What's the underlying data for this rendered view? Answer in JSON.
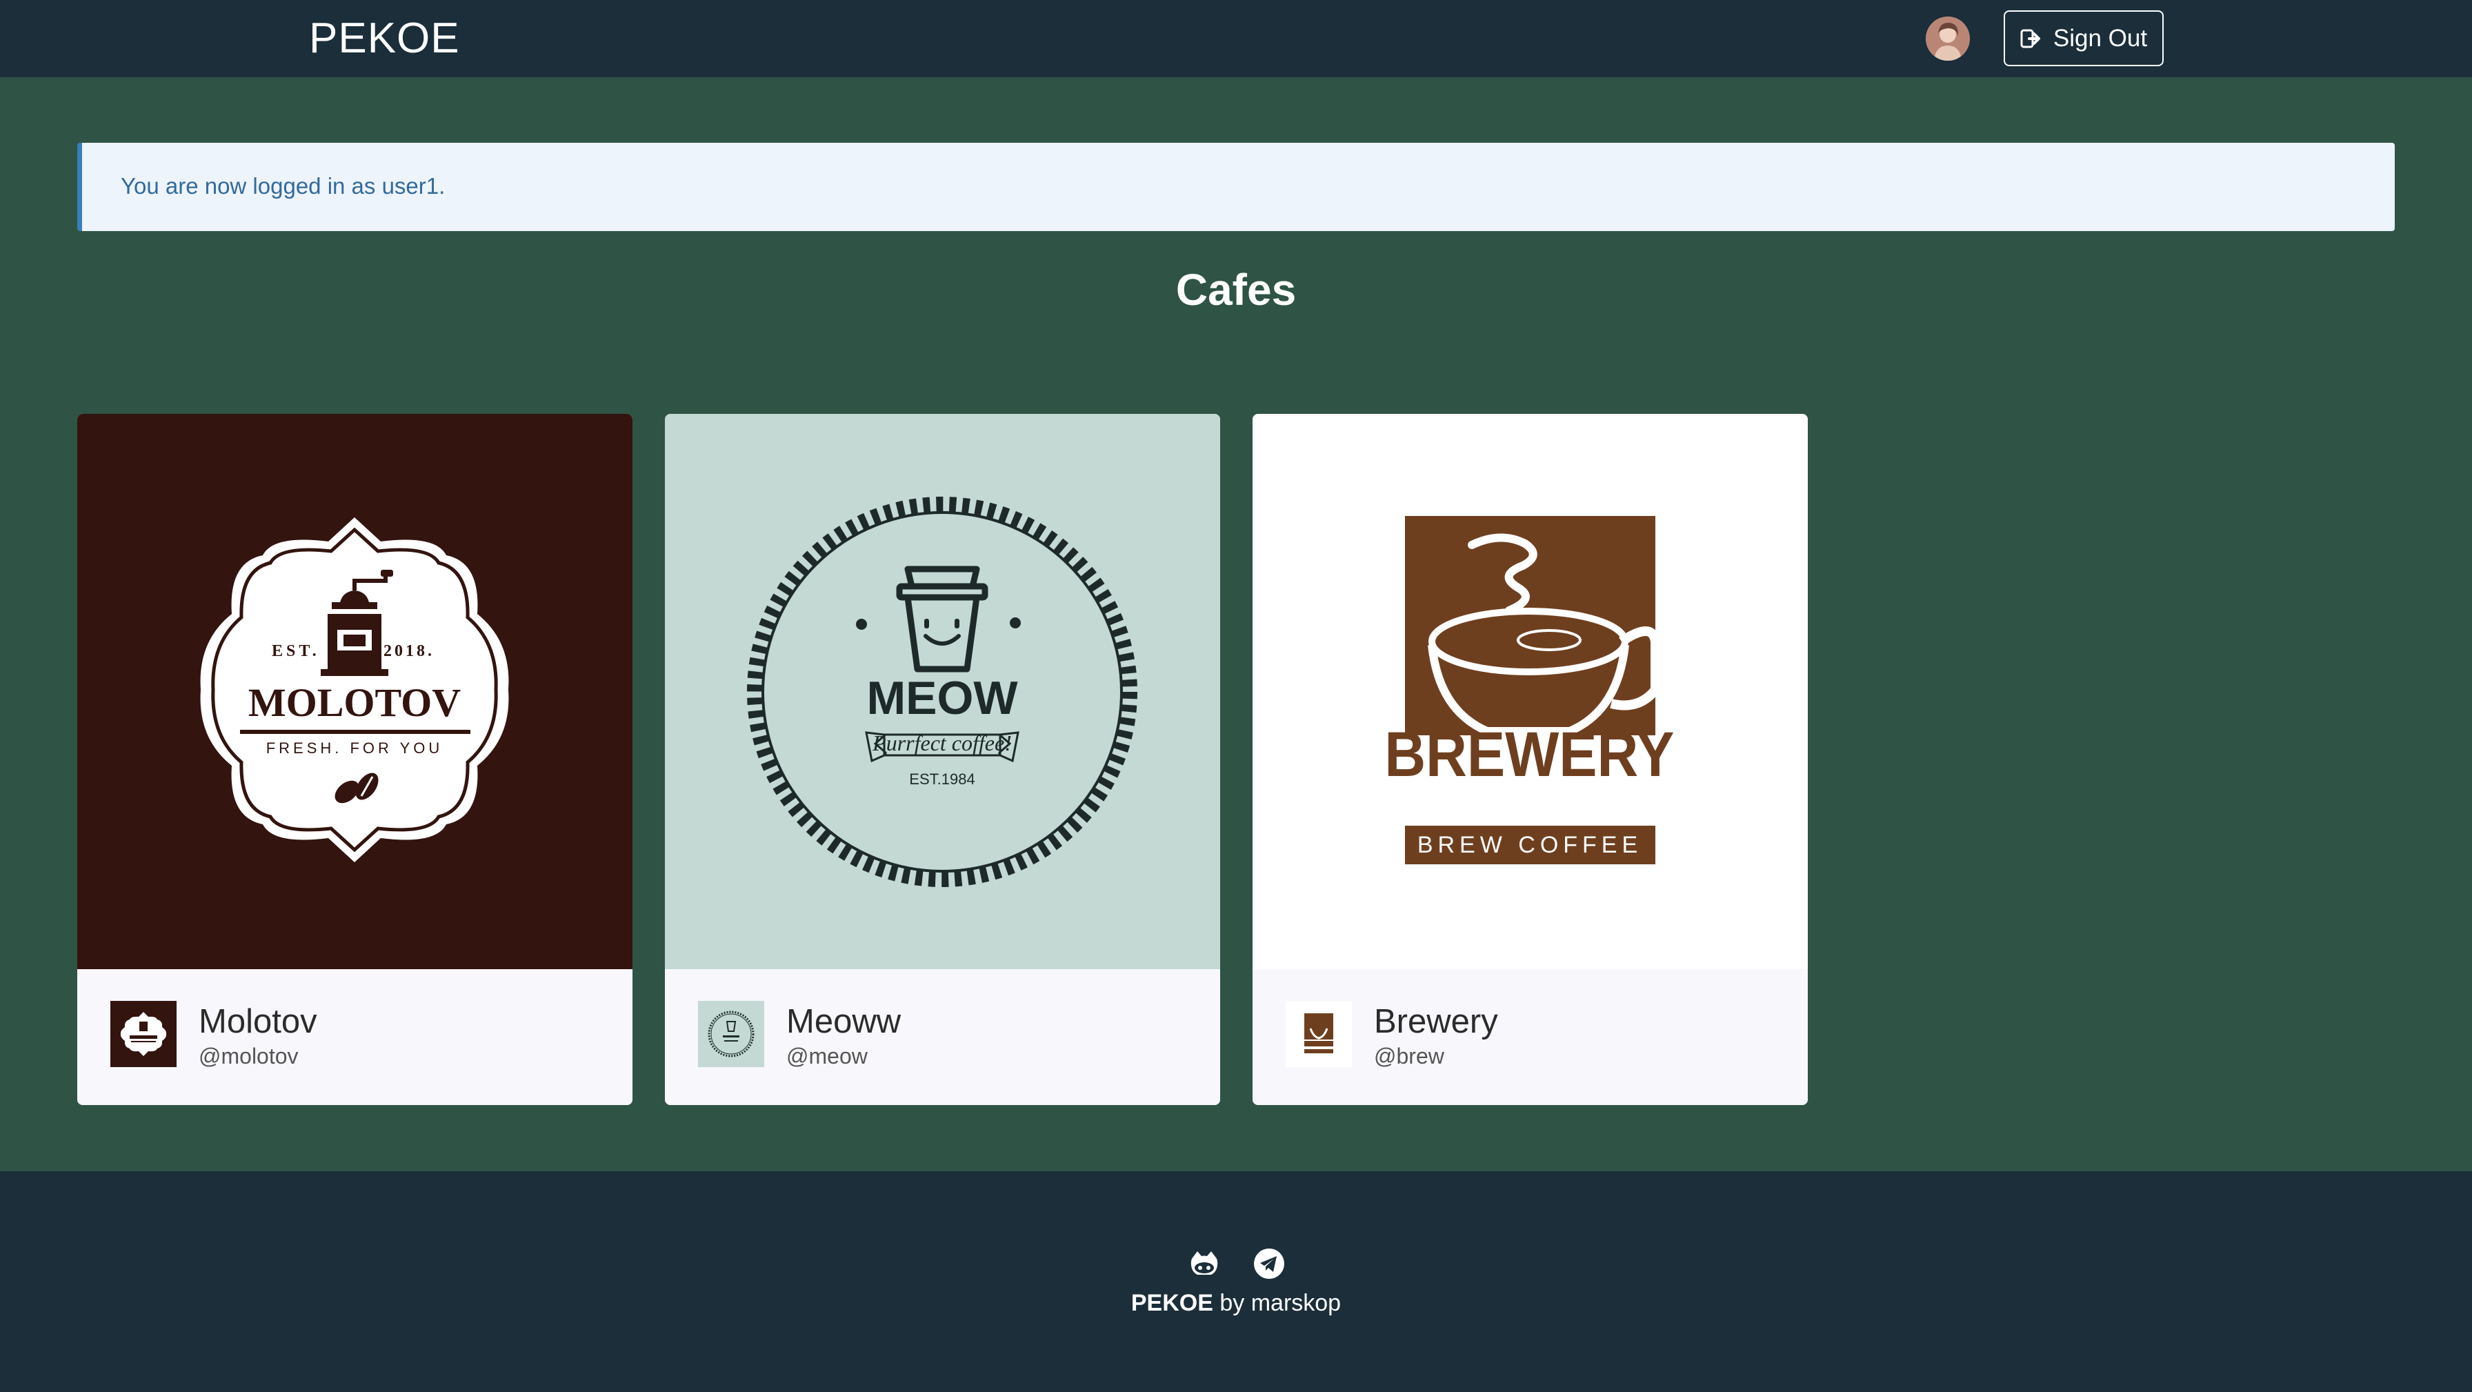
{
  "nav": {
    "brand": "PEKOE",
    "signout_label": "Sign Out",
    "avatar_icon": "user-avatar",
    "signout_icon": "sign-out-icon"
  },
  "alert": {
    "message": "You are now logged in as user1."
  },
  "page": {
    "title": "Cafes"
  },
  "cafes": [
    {
      "name": "Molotov",
      "handle": "@molotov",
      "logo": {
        "est_left": "EST.",
        "est_right": "2018.",
        "wordmark": "MOLOTOV",
        "tagline": "FRESH. FOR YOU",
        "background": "#33140e"
      }
    },
    {
      "name": "Meoww",
      "handle": "@meow",
      "logo": {
        "wordmark": "MEOW",
        "ribbon": "Purrfect coffee!",
        "est": "EST.1984",
        "background": "#c4d9d3"
      }
    },
    {
      "name": "Brewery",
      "handle": "@brew",
      "logo": {
        "wordmark": "BREWERY",
        "banner": "BREW COFFEE",
        "background": "#ffffff",
        "brand_color": "#6e3f1f"
      }
    }
  ],
  "footer": {
    "brand": "PEKOE",
    "byline": " by marskop",
    "icons": [
      "github-icon",
      "telegram-icon"
    ]
  },
  "colors": {
    "navbar": "#1b2e3a",
    "page_background": "#2f5446",
    "alert_background": "#edf4fb",
    "alert_text": "#336a9b"
  }
}
